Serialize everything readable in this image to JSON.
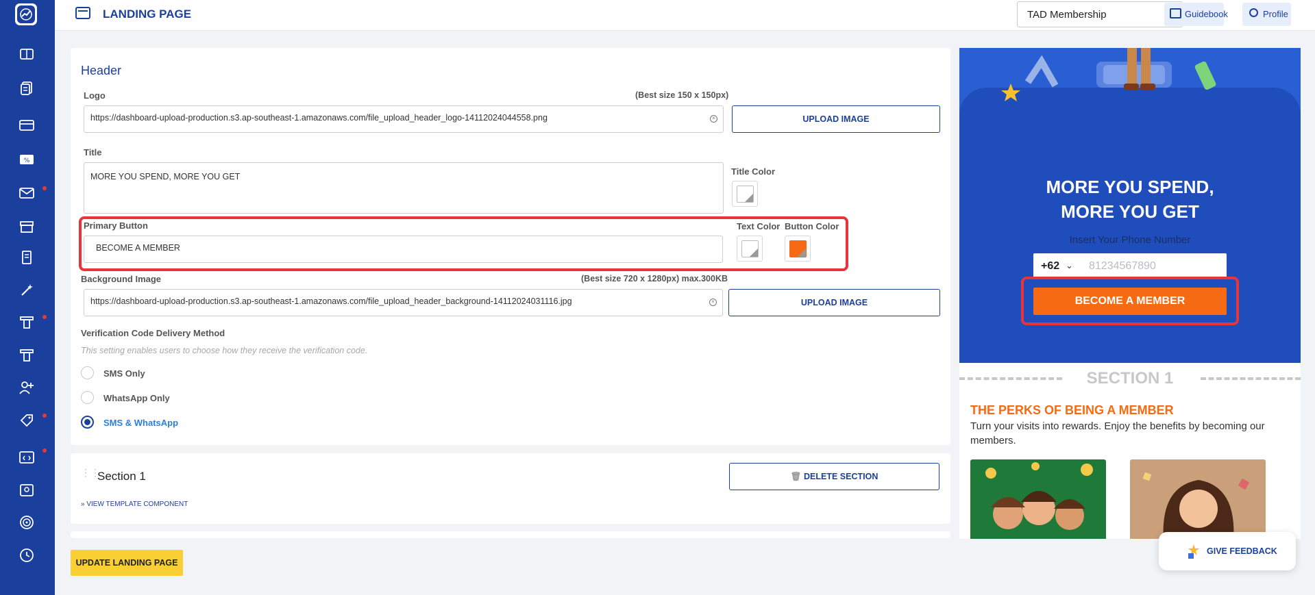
{
  "app": {
    "page_title": "LANDING PAGE"
  },
  "header_bar": {
    "program_select": "TAD Membership",
    "guidebook_label": "Guidebook",
    "profile_label": "Profile"
  },
  "sidebar": {
    "items": [
      {
        "icon": "gallery-icon",
        "badge": false
      },
      {
        "icon": "documents-icon",
        "badge": false
      },
      {
        "icon": "card-icon",
        "badge": false
      },
      {
        "icon": "voucher-icon",
        "badge": false
      },
      {
        "icon": "mail-icon",
        "badge": true
      },
      {
        "icon": "store-icon",
        "badge": false
      },
      {
        "icon": "receipt-icon",
        "badge": false
      },
      {
        "icon": "magic-wand-icon",
        "badge": false
      },
      {
        "icon": "tier-icon",
        "badge": true
      },
      {
        "icon": "tier-alt-icon",
        "badge": false
      },
      {
        "icon": "user-group-icon",
        "badge": false
      },
      {
        "icon": "tag-icon",
        "badge": true
      },
      {
        "icon": "code-window-icon",
        "badge": true
      },
      {
        "icon": "image-user-icon",
        "badge": false
      },
      {
        "icon": "target-icon",
        "badge": false
      },
      {
        "icon": "history-icon",
        "badge": false
      }
    ]
  },
  "header_section": {
    "heading": "Header",
    "logo_label": "Logo",
    "logo_hint": "(Best size 150 x 150px)",
    "logo_value": "https://dashboard-upload-production.s3.ap-southeast-1.amazonaws.com/file_upload_header_logo-14112024044558.png",
    "upload_label": "UPLOAD IMAGE",
    "title_label": "Title",
    "title_value": "MORE YOU SPEND, MORE YOU GET",
    "title_color_label": "Title Color",
    "primary_button_label": "Primary Button",
    "primary_button_value": "BECOME A MEMBER",
    "text_color_label": "Text Color",
    "button_color_label": "Button Color",
    "bg_label": "Background Image",
    "bg_hint": "(Best size 720 x 1280px) max.300KB",
    "bg_value": "https://dashboard-upload-production.s3.ap-southeast-1.amazonaws.com/file_upload_header_background-14112024031116.jpg",
    "verification_label": "Verification Code Delivery Method",
    "verification_hint": "This setting enables users to choose how they receive the verification code.",
    "options": [
      "SMS Only",
      "WhatsApp Only",
      "SMS & WhatsApp"
    ],
    "selected_option": "SMS & WhatsApp"
  },
  "section1": {
    "title": "Section 1",
    "delete_label": "DELETE SECTION",
    "view_template_label": "» VIEW TEMPLATE COMPONENT"
  },
  "footer": {
    "update_label": "UPDATE LANDING PAGE"
  },
  "feedback": {
    "label": "GIVE FEEDBACK"
  },
  "preview": {
    "title_line1": "MORE YOU SPEND,",
    "title_line2": "MORE YOU GET",
    "phone_prompt": "Insert Your Phone Number",
    "country_code": "+62",
    "phone_placeholder": "81234567890",
    "cta_label": "BECOME A MEMBER",
    "section_label": "SECTION 1",
    "perks_title": "THE PERKS OF BEING A MEMBER",
    "perks_desc": "Turn your visits into rewards. Enjoy the benefits by becoming our members."
  },
  "colors": {
    "brand": "#1b3f9c",
    "button_color": "#f56a12",
    "highlight": "#e8343b",
    "update_button": "#f9cf34"
  }
}
